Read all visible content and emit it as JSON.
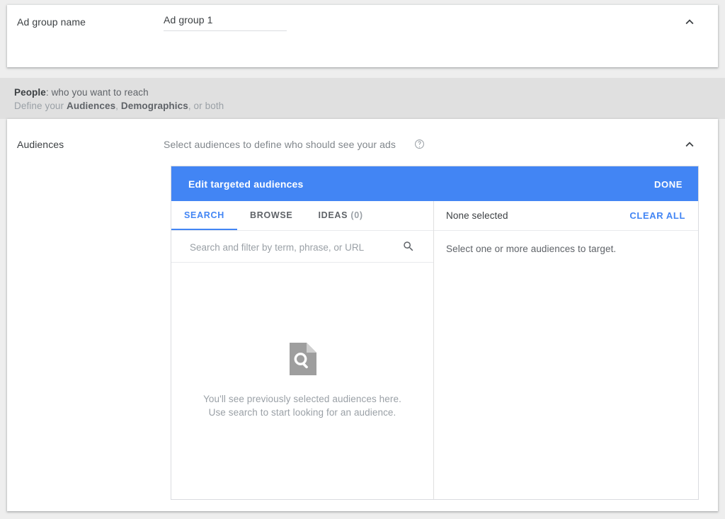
{
  "ad_group": {
    "label": "Ad group name",
    "value": "Ad group 1",
    "placeholder": "Ad group name",
    "collapse_icon": "chevron-up-icon"
  },
  "people_section": {
    "title_strong": "People",
    "title_rest": ": who you want to reach",
    "subtitle_prefix": "Define your ",
    "subtitle_bold_1": "Audiences",
    "subtitle_mid": ", ",
    "subtitle_bold_2": "Demographics",
    "subtitle_suffix": ", or both"
  },
  "audiences_section": {
    "label": "Audiences",
    "description": "Select audiences to define who should see your ads",
    "help_icon": "help-circle-icon",
    "collapse_icon": "chevron-up-icon"
  },
  "editor": {
    "title": "Edit targeted audiences",
    "done_label": "DONE",
    "tabs": [
      {
        "label": "SEARCH",
        "count": "",
        "active": true
      },
      {
        "label": "BROWSE",
        "count": "",
        "active": false
      },
      {
        "label": "IDEAS",
        "count": "(0)",
        "active": false
      }
    ],
    "search": {
      "placeholder": "Search and filter by term, phrase, or URL",
      "value": "",
      "icon": "search-icon"
    },
    "empty_state": {
      "icon": "document-search-icon",
      "line1": "You'll see previously selected audiences here.",
      "line2": "Use search to start looking for an audience."
    },
    "selection": {
      "status": "None selected",
      "clear_all_label": "CLEAR ALL",
      "hint": "Select one or more audiences to target."
    }
  },
  "colors": {
    "accent_blue": "#4285f4",
    "band_grey": "#e0e0e0",
    "page_grey": "#eeeeee",
    "text_primary": "#3c4043",
    "text_secondary": "#5f6368",
    "text_muted": "#9aa0a6"
  }
}
